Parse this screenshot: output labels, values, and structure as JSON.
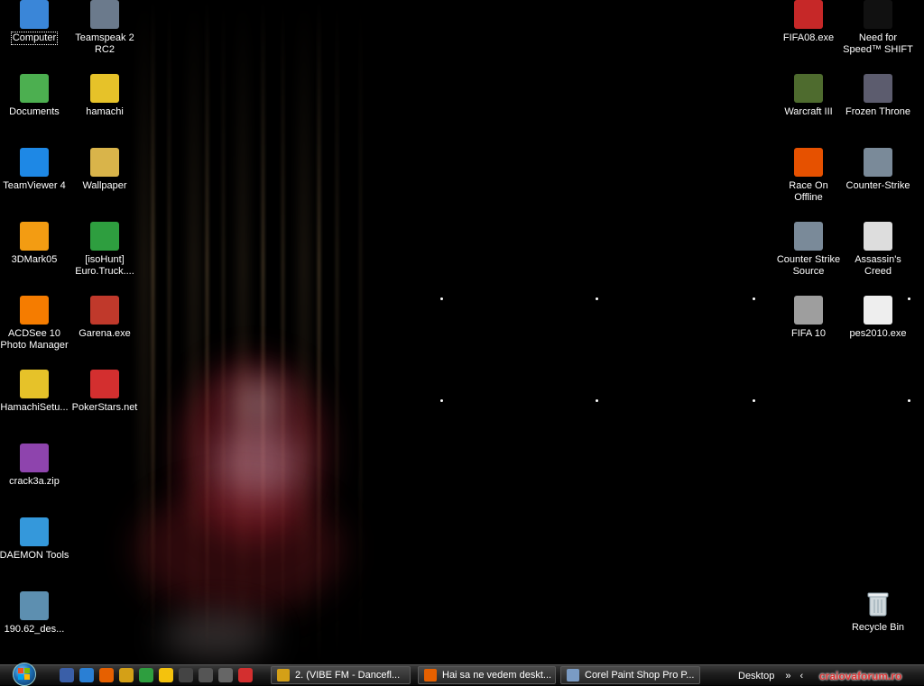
{
  "desktop": {
    "icons_left_col1": [
      {
        "label": "Computer",
        "icon": "computer-icon",
        "color": "#3a86d8",
        "selected": true
      },
      {
        "label": "Documents",
        "icon": "documents-icon",
        "color": "#4caf50"
      },
      {
        "label": "TeamViewer 4",
        "icon": "teamviewer-icon",
        "color": "#1e88e5"
      },
      {
        "label": "3DMark05",
        "icon": "3dmark-icon",
        "color": "#f39c12"
      },
      {
        "label": "ACDSee 10 Photo Manager",
        "icon": "acdsee-icon",
        "color": "#f57c00"
      },
      {
        "label": "HamachiSetu...",
        "icon": "hamachi-setup-icon",
        "color": "#e6c229"
      },
      {
        "label": "crack3a.zip",
        "icon": "winrar-archive-icon",
        "color": "#8e44ad"
      },
      {
        "label": "DAEMON Tools",
        "icon": "daemon-tools-icon",
        "color": "#3498db"
      },
      {
        "label": "190.62_des...",
        "icon": "installer-icon",
        "color": "#5d8fb0"
      }
    ],
    "icons_left_col2": [
      {
        "label": "Teamspeak 2 RC2",
        "icon": "teamspeak-icon",
        "color": "#6b7a8c"
      },
      {
        "label": "hamachi",
        "icon": "hamachi-icon",
        "color": "#e6c229"
      },
      {
        "label": "Wallpaper",
        "icon": "folder-icon",
        "color": "#d9b44a"
      },
      {
        "label": "[isoHunt] Euro.Truck....",
        "icon": "utorrent-icon",
        "color": "#2e9e3f"
      },
      {
        "label": "Garena.exe",
        "icon": "garena-icon",
        "color": "#c0392b"
      },
      {
        "label": "PokerStars.net",
        "icon": "pokerstars-icon",
        "color": "#d32f2f"
      }
    ],
    "icons_right_col1": [
      {
        "label": "FIFA08.exe",
        "icon": "fifa08-icon",
        "color": "#c62828"
      },
      {
        "label": "Warcraft III",
        "icon": "warcraft3-icon",
        "color": "#4e6b2e"
      },
      {
        "label": "Race On Offline",
        "icon": "race-on-icon",
        "color": "#e65100"
      },
      {
        "label": "Counter Strike Source",
        "icon": "counter-strike-source-icon",
        "color": "#7a8a99"
      },
      {
        "label": "FIFA 10",
        "icon": "fifa10-icon",
        "color": "#9e9e9e"
      }
    ],
    "icons_right_col2": [
      {
        "label": "Need for Speed™ SHIFT",
        "icon": "nfs-shift-icon",
        "color": "#111111"
      },
      {
        "label": "Frozen Throne",
        "icon": "frozen-throne-icon",
        "color": "#5c5c6e"
      },
      {
        "label": "Counter-Strike",
        "icon": "counter-strike-icon",
        "color": "#7a8a99"
      },
      {
        "label": "Assassin's Creed",
        "icon": "assassins-creed-icon",
        "color": "#dddddd"
      },
      {
        "label": "pes2010.exe",
        "icon": "pes2010-icon",
        "color": "#eeeeee"
      }
    ],
    "recycle_bin": {
      "label": "Recycle Bin",
      "icon": "recycle-bin-icon"
    }
  },
  "taskbar": {
    "start_icon": "windows-start-orb",
    "quick_launch": [
      {
        "icon": "show-desktop-icon",
        "color": "#3a5fa8"
      },
      {
        "icon": "internet-explorer-icon",
        "color": "#2a7fd4"
      },
      {
        "icon": "firefox-icon",
        "color": "#e66000"
      },
      {
        "icon": "winamp-icon",
        "color": "#d4a017"
      },
      {
        "icon": "utorrent-icon",
        "color": "#2e9e3f"
      },
      {
        "icon": "messenger-icon",
        "color": "#f4c20d"
      },
      {
        "icon": "steam-icon",
        "color": "#444"
      },
      {
        "icon": "media-player-icon",
        "color": "#555"
      },
      {
        "icon": "app-icon",
        "color": "#666"
      },
      {
        "icon": "pokerstars-icon",
        "color": "#d32f2f"
      }
    ],
    "tasks": [
      {
        "label": "2. (VIBE FM - Dancefl...",
        "icon": "winamp-icon",
        "color": "#d4a017"
      },
      {
        "label": "Hai sa ne vedem deskt...",
        "icon": "firefox-icon",
        "color": "#e66000"
      },
      {
        "label": "Corel Paint Shop Pro P...",
        "icon": "paint-shop-pro-icon",
        "color": "#7a9bc4"
      }
    ],
    "tray": {
      "toolbar_label": "Desktop",
      "expand": "»",
      "back": "‹"
    },
    "watermark": "craiovaforum.ro"
  }
}
